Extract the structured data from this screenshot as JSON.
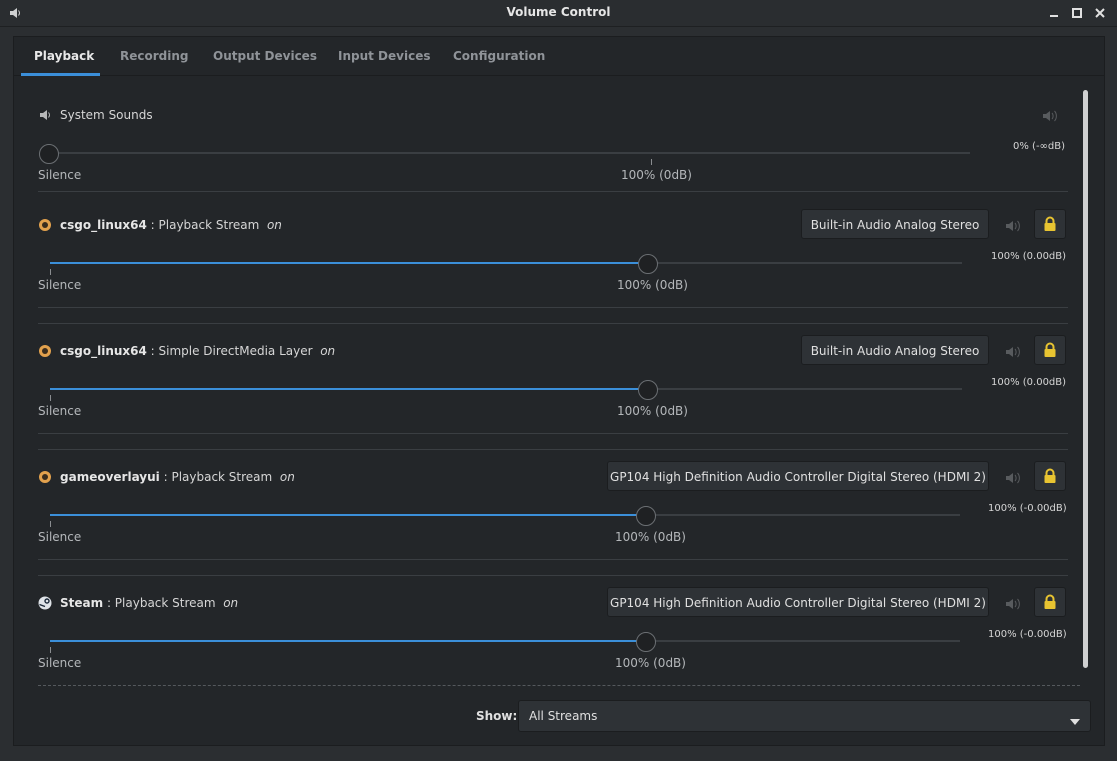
{
  "window": {
    "title": "Volume Control"
  },
  "tabs": [
    "Playback",
    "Recording",
    "Output Devices",
    "Input Devices",
    "Configuration"
  ],
  "system_sounds": {
    "label": "System Sounds",
    "volume_percent": 0,
    "volume_text": "0% (-∞dB)",
    "left_label": "Silence",
    "mid_label": "100% (0dB)"
  },
  "streams": [
    {
      "app": "csgo_linux64",
      "sep": " : ",
      "name": "Playback Stream",
      "state": "on",
      "device": "Built-in Audio Analog Stereo",
      "volume_percent": 100,
      "volume_text": "100% (0.00dB)",
      "left_label": "Silence",
      "mid_label": "100% (0dB)"
    },
    {
      "app": "csgo_linux64",
      "sep": " : ",
      "name": "Simple DirectMedia Layer",
      "state": "on",
      "device": "Built-in Audio Analog Stereo",
      "volume_percent": 100,
      "volume_text": "100% (0.00dB)",
      "left_label": "Silence",
      "mid_label": "100% (0dB)"
    },
    {
      "app": "gameoverlayui",
      "sep": " : ",
      "name": "Playback Stream",
      "state": "on",
      "device": "GP104 High Definition Audio Controller Digital Stereo (HDMI 2)",
      "volume_percent": 100,
      "volume_text": "100% (-0.00dB)",
      "left_label": "Silence",
      "mid_label": "100% (0dB)"
    },
    {
      "app": "Steam",
      "sep": " : ",
      "name": "Playback Stream",
      "state": "on",
      "device": "GP104 High Definition Audio Controller Digital Stereo (HDMI 2)",
      "volume_percent": 100,
      "volume_text": "100% (-0.00dB)",
      "left_label": "Silence",
      "mid_label": "100% (0dB)"
    }
  ],
  "show": {
    "label": "Show:",
    "value": "All Streams"
  },
  "colors": {
    "accent": "#3b8fd9",
    "lock": "#e8c431"
  }
}
